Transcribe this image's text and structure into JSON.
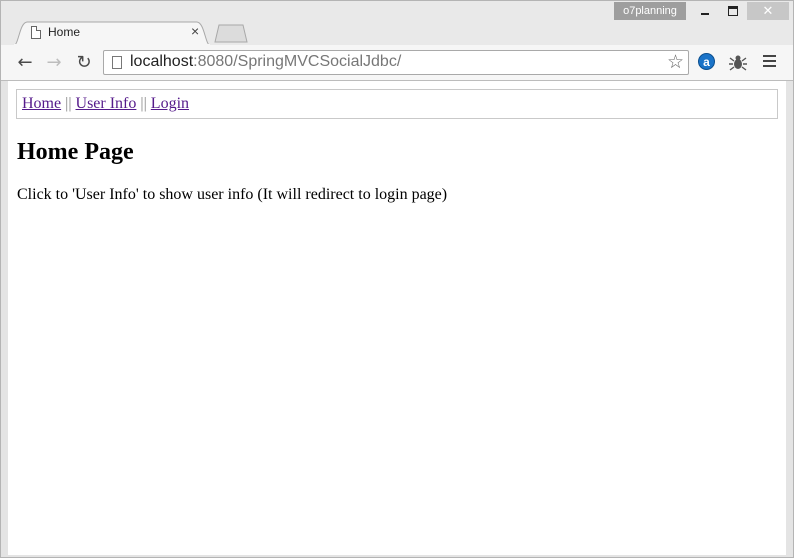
{
  "window": {
    "profile_name": "o7planning",
    "close_glyph": "✕"
  },
  "tab": {
    "title": "Home",
    "close_glyph": "×"
  },
  "toolbar": {
    "back_glyph": "←",
    "forward_glyph": "→",
    "reload_glyph": "↻",
    "url_host": "localhost",
    "url_rest": ":8080/SpringMVCSocialJdbc/",
    "star_glyph": "☆",
    "extension_letter": "a"
  },
  "icons": {
    "back": "back-arrow-icon",
    "forward": "forward-arrow-icon",
    "reload": "reload-icon",
    "page": "page-icon",
    "bookmark": "star-icon",
    "extension_a": "extension-a-icon",
    "extension_bug": "bug-icon",
    "menu": "hamburger-menu-icon"
  },
  "page": {
    "nav": {
      "home": "Home",
      "separator": "||",
      "user_info": "User Info",
      "login": "Login"
    },
    "heading": "Home Page",
    "description": "Click to 'User Info' to show user info (It will redirect to login page)"
  },
  "colors": {
    "visited_link": "#551a8b",
    "extension_blue": "#1a73c8",
    "titlebar_bg": "#e9e9e9"
  }
}
